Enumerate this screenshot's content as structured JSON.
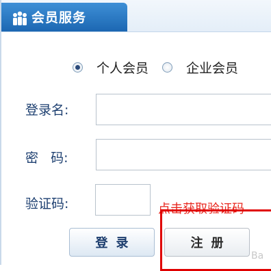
{
  "header": {
    "title": "会员服务",
    "icon": "members-icon"
  },
  "member_type": {
    "options": [
      {
        "label": "个人会员",
        "selected": true
      },
      {
        "label": "企业会员",
        "selected": false
      }
    ]
  },
  "form": {
    "username_label": "登录名:",
    "username_value": "",
    "password_label": "密   码:",
    "password_value": "",
    "captcha_label": "验证码:",
    "captcha_value": "",
    "captcha_link": "点击获取验证码"
  },
  "buttons": {
    "login": "登录",
    "register": "注册"
  },
  "watermark": "Ba",
  "colors": {
    "header_blue": "#1c67b2",
    "label_blue": "#1d3f70",
    "captcha_red": "#e8261d",
    "highlight_red": "#e00000"
  }
}
